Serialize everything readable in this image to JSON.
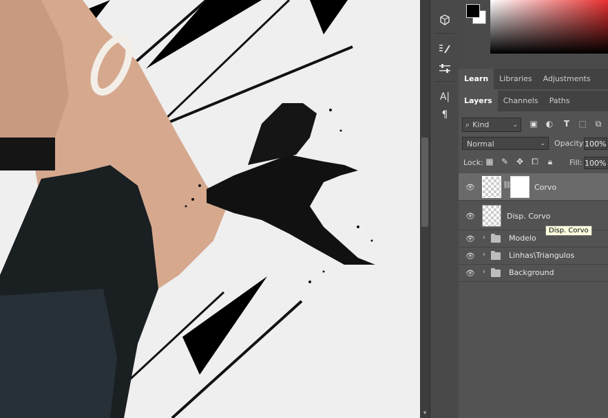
{
  "toolstrip": {
    "icons": [
      "3d-cube-icon",
      "brush-list-icon",
      "sliders-icon",
      "character-icon",
      "paragraph-icon"
    ],
    "character_glyph": "A|",
    "paragraph_glyph": "¶"
  },
  "color_panel": {
    "foreground": "#000000",
    "background": "#ffffff"
  },
  "top_tabs": [
    "Learn",
    "Libraries",
    "Adjustments"
  ],
  "top_tabs_active": "Learn",
  "layer_tabs": [
    "Layers",
    "Channels",
    "Paths"
  ],
  "layer_tabs_active": "Layers",
  "filter": {
    "kind_label": "Kind",
    "icons": [
      "image-filter-icon",
      "adjustment-filter-icon",
      "type-filter-icon",
      "shape-filter-icon",
      "smart-object-filter-icon"
    ]
  },
  "blend": {
    "mode": "Normal",
    "opacity_label": "Opacity:",
    "opacity_value": "100%",
    "lock_label": "Lock:",
    "fill_label": "Fill:",
    "fill_value": "100%"
  },
  "layers": [
    {
      "name": "Corvo",
      "type": "layer-with-mask",
      "selected": true
    },
    {
      "name": "Disp. Corvo",
      "type": "layer",
      "selected": false
    },
    {
      "name": "Modelo",
      "type": "group",
      "selected": false
    },
    {
      "name": "Linhas\\Triangulos",
      "type": "group",
      "selected": false
    },
    {
      "name": "Background",
      "type": "group",
      "selected": false
    }
  ],
  "tooltip": "Disp. Corvo"
}
